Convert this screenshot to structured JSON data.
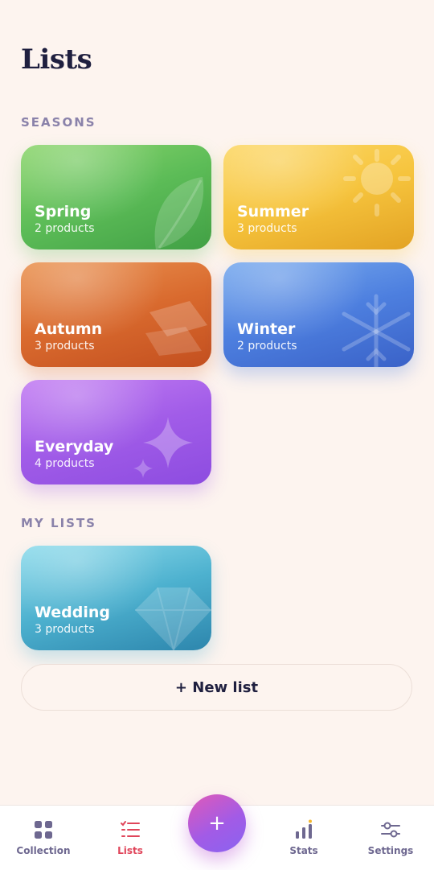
{
  "page": {
    "title": "Lists"
  },
  "sections": {
    "seasons": {
      "label": "SEASONS",
      "cards": [
        {
          "name": "Spring",
          "count": "2 products",
          "color": "#5cbc57",
          "icon": "leaf-icon"
        },
        {
          "name": "Summer",
          "count": "3 products",
          "color": "#f6c43d",
          "icon": "sun-icon"
        },
        {
          "name": "Autumn",
          "count": "3 products",
          "color": "#d96a2e",
          "icon": "fallen-leaves-icon"
        },
        {
          "name": "Winter",
          "count": "2 products",
          "color": "#4d7fdf",
          "icon": "snowflake-icon"
        },
        {
          "name": "Everyday",
          "count": "4 products",
          "color": "#a15ce8",
          "icon": "sparkle-icon"
        }
      ]
    },
    "my_lists": {
      "label": "MY LISTS",
      "cards": [
        {
          "name": "Wedding",
          "count": "3 products",
          "color": "#4db1cf",
          "icon": "diamond-icon"
        }
      ]
    }
  },
  "new_list": {
    "label": "+ New list"
  },
  "tabbar": {
    "tabs": [
      {
        "label": "Collection",
        "icon": "grid-icon",
        "active": false
      },
      {
        "label": "Lists",
        "icon": "checklist-icon",
        "active": true
      },
      {
        "label": "Stats",
        "icon": "bar-chart-icon",
        "active": false
      },
      {
        "label": "Settings",
        "icon": "sliders-icon",
        "active": false
      }
    ],
    "fab": {
      "label": "+",
      "icon": "plus-icon"
    },
    "active_color": "#e0455a",
    "inactive_color": "#6e6890"
  }
}
